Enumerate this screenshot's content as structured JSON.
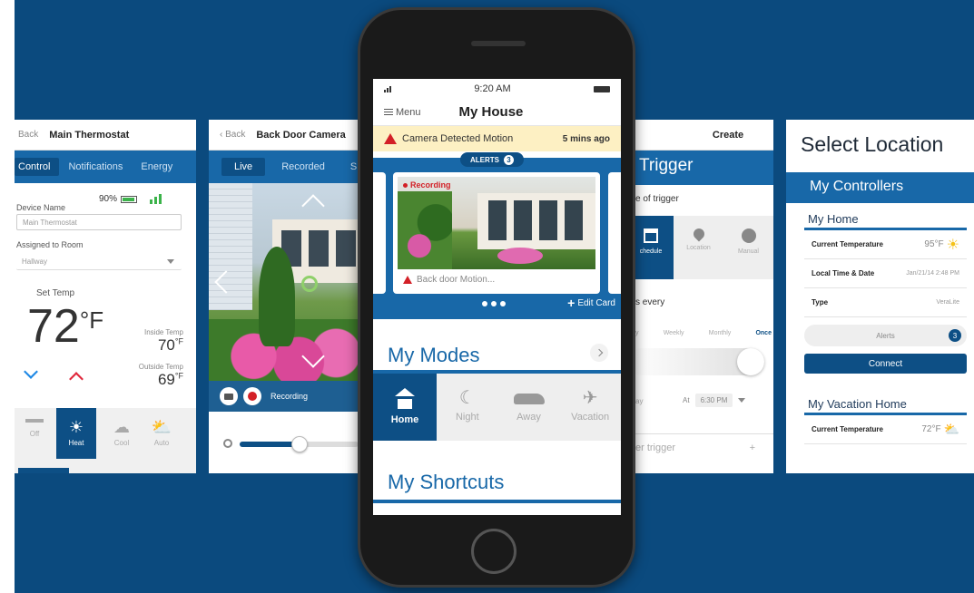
{
  "thermostat": {
    "back": "Back",
    "title": "Main Thermostat",
    "tabs": [
      "Control",
      "Notifications",
      "Energy"
    ],
    "device_name_label": "Device Name",
    "battery": "90%",
    "device_name_value": "Main Thermostat",
    "assigned_room_label": "Assigned to Room",
    "assigned_room_value": "Hallway",
    "set_temp_label": "Set Temp",
    "set_temp_value": "72",
    "set_temp_unit": "°F",
    "inside_label": "Inside Temp",
    "inside_value": "70",
    "outside_label": "Outside Temp",
    "outside_value": "69",
    "temp_unit": "°F",
    "modes": [
      "Off",
      "Heat",
      "Cool",
      "Auto"
    ],
    "active_mode": "Heat"
  },
  "camera": {
    "back": "Back",
    "title": "Back Door Camera",
    "tabs": [
      "Live",
      "Recorded",
      "S"
    ],
    "recording_label": "Recording",
    "zoom_level": 0.5
  },
  "phone": {
    "time": "9:20 AM",
    "menu_label": "Menu",
    "title": "My House",
    "alert_text": "Camera Detected Motion",
    "alert_time": "5 mins ago",
    "alerts_label": "ALERTS",
    "alerts_count": "3",
    "card_badge": "Recording",
    "card_caption": "Back door Motion...",
    "edit_card_label": "Edit Card",
    "my_modes_title": "My Modes",
    "modes": [
      {
        "label": "Home",
        "icon": "home-icon"
      },
      {
        "label": "Night",
        "icon": "moon-icon"
      },
      {
        "label": "Away",
        "icon": "car-icon"
      },
      {
        "label": "Vacation",
        "icon": "plane-icon"
      }
    ],
    "my_shortcuts_title": "My Shortcuts"
  },
  "create": {
    "title": "Create",
    "banner": "Trigger",
    "type_label": "e of trigger",
    "types": [
      "chedule",
      "Location",
      "Manual"
    ],
    "repeat_label": "s every",
    "frequencies": [
      "y",
      "Weekly",
      "Monthly",
      "Once"
    ],
    "at_prefix": "ay",
    "at_label": "At",
    "at_value": "6:30 PM",
    "add_trigger": "er trigger"
  },
  "location": {
    "title": "Select Location",
    "controllers": "My Controllers",
    "home_name": "My Home",
    "current_temp_label": "Current Temperature",
    "home_temp": "95°F",
    "local_time_label": "Local Time & Date",
    "local_time_value": "Jan/21/14 2:48 PM",
    "type_label": "Type",
    "type_value": "VeraLite",
    "alerts_label": "Alerts",
    "alerts_count": "3",
    "connect_label": "Connect",
    "vacation_name": "My Vacation Home",
    "vacation_temp": "72°F"
  },
  "colors": {
    "primary": "#1868a8",
    "dark": "#0d4f85",
    "background": "#0b4a7e",
    "alert": "#d32027"
  }
}
